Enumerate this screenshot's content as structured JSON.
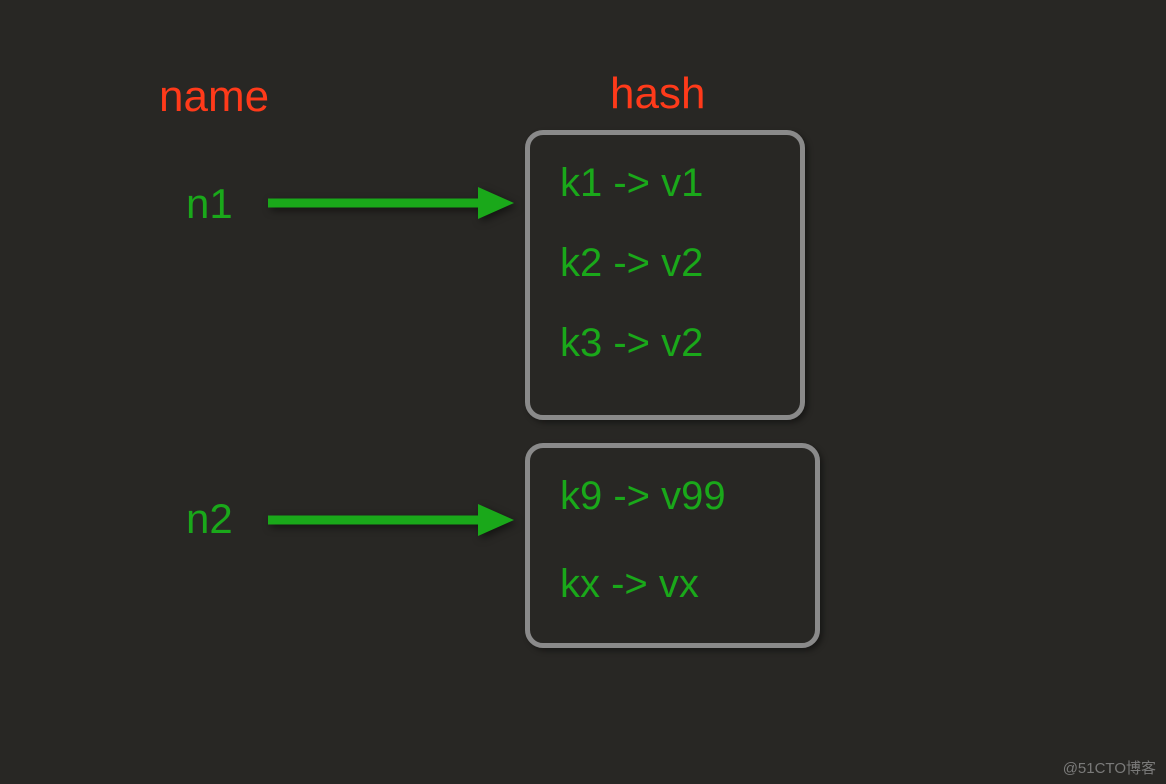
{
  "headers": {
    "name": "name",
    "hash": "hash"
  },
  "names": {
    "n1": "n1",
    "n2": "n2"
  },
  "hashes": {
    "box1": [
      "k1 -> v1",
      "k2 -> v2",
      "k3 -> v2"
    ],
    "box2": [
      "k9 -> v99",
      "kx -> vx"
    ]
  },
  "watermark": "@51CTO博客"
}
